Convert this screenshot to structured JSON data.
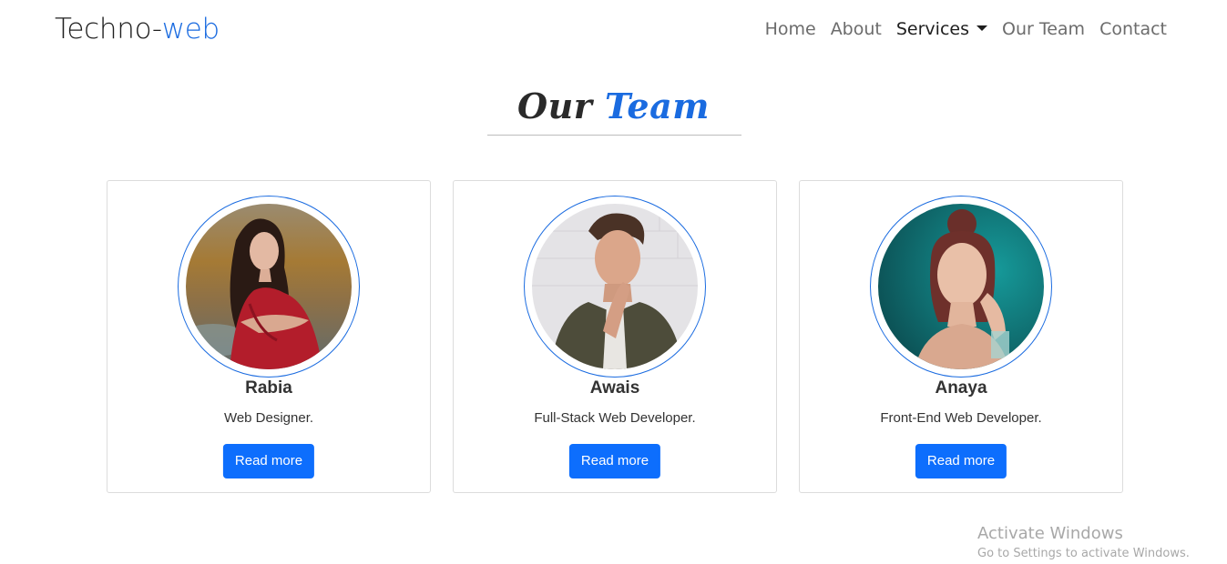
{
  "brand": {
    "main": "Techno-",
    "accent": "web"
  },
  "nav": {
    "items": [
      {
        "label": "Home"
      },
      {
        "label": "About"
      },
      {
        "label": "Services"
      },
      {
        "label": "Our Team"
      },
      {
        "label": "Contact"
      }
    ]
  },
  "section": {
    "title_main": "Our ",
    "title_accent": "Team"
  },
  "team": [
    {
      "name": "Rabia",
      "role": "Web Designer.",
      "button": "Read more"
    },
    {
      "name": "Awais",
      "role": "Full-Stack Web Developer.",
      "button": "Read more"
    },
    {
      "name": "Anaya",
      "role": "Front-End Web Developer.",
      "button": "Read more"
    }
  ],
  "watermark": {
    "title": "Activate Windows",
    "subtitle": "Go to Settings to activate Windows."
  },
  "colors": {
    "accent": "#1a6be0",
    "button": "#0d6efd"
  }
}
